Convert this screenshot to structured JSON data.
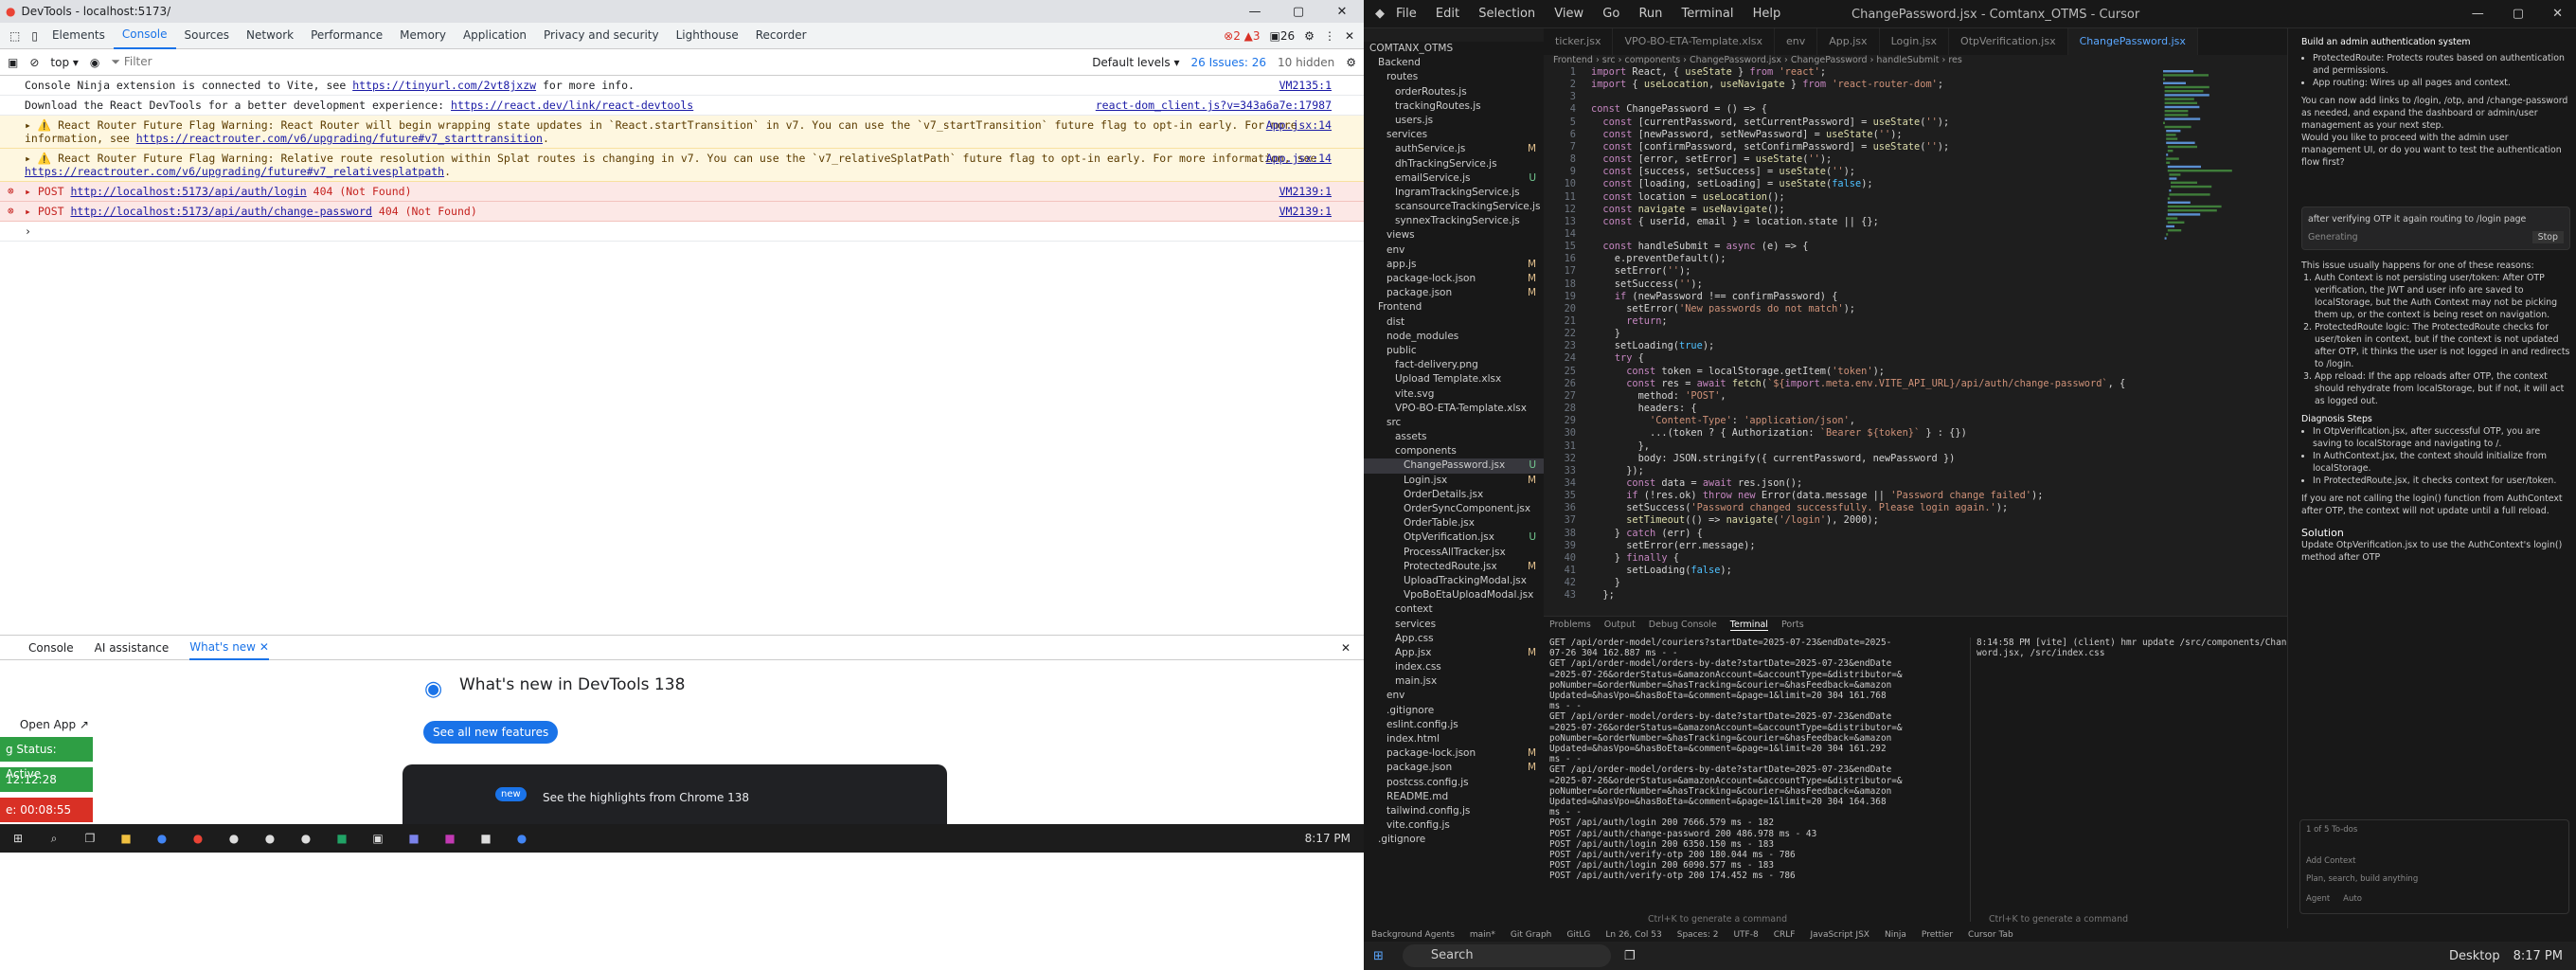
{
  "devtools": {
    "title": "DevTools - localhost:5173/",
    "tabs": [
      "Elements",
      "Console",
      "Sources",
      "Network",
      "Performance",
      "Memory",
      "Application",
      "Privacy and security",
      "Lighthouse",
      "Recorder"
    ],
    "badges": {
      "errors": "2",
      "warnings": "3",
      "info": "26"
    },
    "context": "top",
    "filter_placeholder": "Filter",
    "levels": "Default levels",
    "issues": "26 Issues: 26",
    "hidden": "10 hidden",
    "lines": [
      {
        "type": "log",
        "text": "Console Ninja extension is connected to Vite, see ",
        "link": "https://tinyurl.com/2vt8jxzw",
        "tail": " for more info.",
        "src": "VM2135:1"
      },
      {
        "type": "log",
        "text": "Download the React DevTools for a better development experience: ",
        "link": "https://react.dev/link/react-devtools",
        "tail": "",
        "src": "react-dom_client.js?v=343a6a7e:17987"
      },
      {
        "type": "warn",
        "text": "▸ ⚠️ React Router Future Flag Warning: React Router will begin wrapping state updates in `React.startTransition` in v7. You can use the `v7_startTransition` future flag to opt-in early. For more information, see ",
        "link": "https://reactrouter.com/v6/upgrading/future#v7_starttransition",
        "tail": ".",
        "src": "App.jsx:14"
      },
      {
        "type": "warn",
        "text": "▸ ⚠️ React Router Future Flag Warning: Relative route resolution within Splat routes is changing in v7. You can use the `v7_relativeSplatPath` future flag to opt-in early. For more information, see ",
        "link": "https://reactrouter.com/v6/upgrading/future#v7_relativesplatpath",
        "tail": ".",
        "src": "App.jsx:14"
      },
      {
        "type": "err",
        "text": "▸ POST ",
        "link": "http://localhost:5173/api/auth/login",
        "tail": " 404 (Not Found)",
        "src": "VM2139:1"
      },
      {
        "type": "err",
        "text": "▸ POST ",
        "link": "http://localhost:5173/api/auth/change-password",
        "tail": " 404 (Not Found)",
        "src": "VM2139:1"
      }
    ],
    "drawer_tabs": [
      "Console",
      "AI assistance",
      "What's new"
    ],
    "whats_new_title": "What's new in DevTools 138",
    "see_all": "See all new features",
    "card_new": "new",
    "card_text": "See the highlights from Chrome 138",
    "side": {
      "open_app": "Open App ↗",
      "status": "g Status: Active",
      "t1": "12:12:28",
      "t2": "e: 00:08:55"
    },
    "clock": "8:17 PM"
  },
  "cursor": {
    "menu": [
      "File",
      "Edit",
      "Selection",
      "View",
      "Go",
      "Run",
      "Terminal",
      "Help"
    ],
    "title": "ChangePassword.jsx - Comtanx_OTMS - Cursor",
    "tabs": [
      "ticker.jsx",
      "VPO-BO-ETA-Template.xlsx",
      "env",
      "App.jsx",
      "Login.jsx",
      "OtpVerification.jsx",
      "ChangePassword.jsx"
    ],
    "breadcrumb": "Frontend › src › components › ChangePassword.jsx › ChangePassword › handleSubmit › res",
    "explorer": [
      {
        "t": "COMTANX_OTMS",
        "i": 0
      },
      {
        "t": "Backend",
        "i": 1
      },
      {
        "t": "routes",
        "i": 2
      },
      {
        "t": "orderRoutes.js",
        "i": 3
      },
      {
        "t": "trackingRoutes.js",
        "i": 3
      },
      {
        "t": "users.js",
        "i": 3
      },
      {
        "t": "services",
        "i": 2
      },
      {
        "t": "authService.js",
        "i": 3,
        "b": "M"
      },
      {
        "t": "dhTrackingService.js",
        "i": 3
      },
      {
        "t": "emailService.js",
        "i": 3,
        "b": "U"
      },
      {
        "t": "IngramTrackingService.js",
        "i": 3
      },
      {
        "t": "scansourceTrackingService.js",
        "i": 3
      },
      {
        "t": "synnexTrackingService.js",
        "i": 3
      },
      {
        "t": "views",
        "i": 2
      },
      {
        "t": "env",
        "i": 2
      },
      {
        "t": "app.js",
        "i": 2,
        "b": "M"
      },
      {
        "t": "package-lock.json",
        "i": 2,
        "b": "M"
      },
      {
        "t": "package.json",
        "i": 2,
        "b": "M"
      },
      {
        "t": "Frontend",
        "i": 1
      },
      {
        "t": "dist",
        "i": 2
      },
      {
        "t": "node_modules",
        "i": 2
      },
      {
        "t": "public",
        "i": 2
      },
      {
        "t": "fact-delivery.png",
        "i": 3
      },
      {
        "t": "Upload Template.xlsx",
        "i": 3
      },
      {
        "t": "vite.svg",
        "i": 3
      },
      {
        "t": "VPO-BO-ETA-Template.xlsx",
        "i": 3
      },
      {
        "t": "src",
        "i": 2
      },
      {
        "t": "assets",
        "i": 3
      },
      {
        "t": "components",
        "i": 3
      },
      {
        "t": "ChangePassword.jsx",
        "i": 4,
        "b": "U",
        "s": true
      },
      {
        "t": "Login.jsx",
        "i": 4,
        "b": "M"
      },
      {
        "t": "OrderDetails.jsx",
        "i": 4
      },
      {
        "t": "OrderSyncComponent.jsx",
        "i": 4
      },
      {
        "t": "OrderTable.jsx",
        "i": 4
      },
      {
        "t": "OtpVerification.jsx",
        "i": 4,
        "b": "U"
      },
      {
        "t": "ProcessAllTracker.jsx",
        "i": 4
      },
      {
        "t": "ProtectedRoute.jsx",
        "i": 4,
        "b": "M"
      },
      {
        "t": "UploadTrackingModal.jsx",
        "i": 4
      },
      {
        "t": "VpoBoEtaUploadModal.jsx",
        "i": 4
      },
      {
        "t": "context",
        "i": 3
      },
      {
        "t": "services",
        "i": 3
      },
      {
        "t": "App.css",
        "i": 3
      },
      {
        "t": "App.jsx",
        "i": 3,
        "b": "M"
      },
      {
        "t": "index.css",
        "i": 3
      },
      {
        "t": "main.jsx",
        "i": 3
      },
      {
        "t": "env",
        "i": 2
      },
      {
        "t": ".gitignore",
        "i": 2
      },
      {
        "t": "eslint.config.js",
        "i": 2
      },
      {
        "t": "index.html",
        "i": 2
      },
      {
        "t": "package-lock.json",
        "i": 2,
        "b": "M"
      },
      {
        "t": "package.json",
        "i": 2,
        "b": "M"
      },
      {
        "t": "postcss.config.js",
        "i": 2
      },
      {
        "t": "README.md",
        "i": 2
      },
      {
        "t": "tailwind.config.js",
        "i": 2
      },
      {
        "t": "vite.config.js",
        "i": 2
      },
      {
        "t": ".gitignore",
        "i": 1
      }
    ],
    "code": [
      "import React, { useState } from 'react';",
      "import { useLocation, useNavigate } from 'react-router-dom';",
      "",
      "const ChangePassword = () => {",
      "  const [currentPassword, setCurrentPassword] = useState('');",
      "  const [newPassword, setNewPassword] = useState('');",
      "  const [confirmPassword, setConfirmPassword] = useState('');",
      "  const [error, setError] = useState('');",
      "  const [success, setSuccess] = useState('');",
      "  const [loading, setLoading] = useState(false);",
      "  const location = useLocation();",
      "  const navigate = useNavigate();",
      "  const { userId, email } = location.state || {};",
      "",
      "  const handleSubmit = async (e) => {",
      "    e.preventDefault();",
      "    setError('');",
      "    setSuccess('');",
      "    if (newPassword !== confirmPassword) {",
      "      setError('New passwords do not match');",
      "      return;",
      "    }",
      "    setLoading(true);",
      "    try {",
      "      const token = localStorage.getItem('token');",
      "      const res = await fetch(`${import.meta.env.VITE_API_URL}/api/auth/change-password`, {",
      "        method: 'POST',",
      "        headers: {",
      "          'Content-Type': 'application/json',",
      "          ...(token ? { Authorization: `Bearer ${token}` } : {})",
      "        },",
      "        body: JSON.stringify({ currentPassword, newPassword })",
      "      });",
      "      const data = await res.json();",
      "      if (!res.ok) throw new Error(data.message || 'Password change failed');",
      "      setSuccess('Password changed successfully. Please login again.');",
      "      setTimeout(() => navigate('/login'), 2000);",
      "    } catch (err) {",
      "      setError(err.message);",
      "    } finally {",
      "      setLoading(false);",
      "    }",
      "  };"
    ],
    "term_tabs": [
      "Problems",
      "Output",
      "Debug Console",
      "Terminal",
      "Ports"
    ],
    "term_left": [
      "GET /api/order-model/couriers?startDate=2025-07-23&endDate=2025-",
      "07-26 304 162.887 ms - -",
      "GET /api/order-model/orders-by-date?startDate=2025-07-23&endDate",
      "=2025-07-26&orderStatus=&amazonAccount=&accountType=&distributor=&",
      "poNumber=&orderNumber=&hasTracking=&courier=&hasFeedback=&amazon",
      "Updated=&hasVpo=&hasBoEta=&comment=&page=1&limit=20 304 161.768",
      "ms - -",
      "GET /api/order-model/orders-by-date?startDate=2025-07-23&endDate",
      "=2025-07-26&orderStatus=&amazonAccount=&accountType=&distributor=&",
      "poNumber=&orderNumber=&hasTracking=&courier=&hasFeedback=&amazon",
      "Updated=&hasVpo=&hasBoEta=&comment=&page=1&limit=20 304 161.292",
      "ms - -",
      "GET /api/order-model/orders-by-date?startDate=2025-07-23&endDate",
      "=2025-07-26&orderStatus=&amazonAccount=&accountType=&distributor=&",
      "poNumber=&orderNumber=&hasTracking=&courier=&hasFeedback=&amazon",
      "Updated=&hasVpo=&hasBoEta=&comment=&page=1&limit=20 304 164.368",
      "ms - -",
      "POST /api/auth/login 200 7666.579 ms - 182",
      "POST /api/auth/change-password 200 486.978 ms - 43",
      "POST /api/auth/login 200 6350.150 ms - 183",
      "POST /api/auth/verify-otp 200 180.044 ms - 786",
      "POST /api/auth/login 200 6090.577 ms - 183",
      "POST /api/auth/verify-otp 200 174.452 ms - 786"
    ],
    "term_right": [
      "8:14:58 PM [vite] (client) hmr update /src/components/ChangePass",
      "word.jsx, /src/index.css"
    ],
    "term_hint": "Ctrl+K to generate a command",
    "chat": {
      "header": "Build an admin authentication system",
      "p1": "ProtectedRoute: Protects routes based on authentication and permissions.",
      "p2": "App routing: Wires up all pages and context.",
      "p3": "You can now add links to /login, /otp, and /change-password as needed, and expand the dashboard or admin/user management as your next step.",
      "p4": "Would you like to proceed with the admin user management UI, or do you want to test the authentication flow first?",
      "user_msg": "after verifying OTP it again routing to /login page",
      "generating": "Generating",
      "stop": "Stop",
      "p5": "This issue usually happens for one of these reasons:",
      "r1": "Auth Context is not persisting user/token: After OTP verification, the JWT and user info are saved to localStorage, but the Auth Context may not be picking them up, or the context is being reset on navigation.",
      "r2": "ProtectedRoute logic: The ProtectedRoute checks for user/token in context, but if the context is not updated after OTP, it thinks the user is not logged in and redirects to /login.",
      "r3": "App reload: If the app reloads after OTP, the context should rehydrate from localStorage, but if not, it will act as logged out.",
      "h1": "Diagnosis Steps",
      "d1": "In OtpVerification.jsx, after successful OTP, you are saving to localStorage and navigating to /.",
      "d2": "In AuthContext.jsx, the context should initialize from localStorage.",
      "d3": "In ProtectedRoute.jsx, it checks context for user/token.",
      "p6": "If you are not calling the login() function from AuthContext after OTP, the context will not update until a full reload.",
      "h2": "Solution",
      "p7": "Update OtpVerification.jsx to use the AuthContext's login() method after OTP",
      "todos": "1 of 5 To-dos",
      "add_context": "Add Context",
      "input_placeholder": "Plan, search, build anything",
      "agent": "Agent",
      "auto": "Auto"
    },
    "status": [
      "Background Agents",
      "main*",
      "Git Graph",
      "GitLG",
      "Ln 26, Col 53",
      "Spaces: 2",
      "UTF-8",
      "CRLF",
      "JavaScript JSX",
      "Ninja",
      "Prettier",
      "Cursor Tab"
    ],
    "search_placeholder": "Search",
    "clock": "8:17 PM",
    "desktop": "Desktop"
  },
  "colors": {
    "accent": "#1a73e8",
    "warn_bg": "#fef7e0",
    "err_bg": "#fce8e6",
    "status_green": "#2e9e44",
    "status_red": "#d93025"
  }
}
